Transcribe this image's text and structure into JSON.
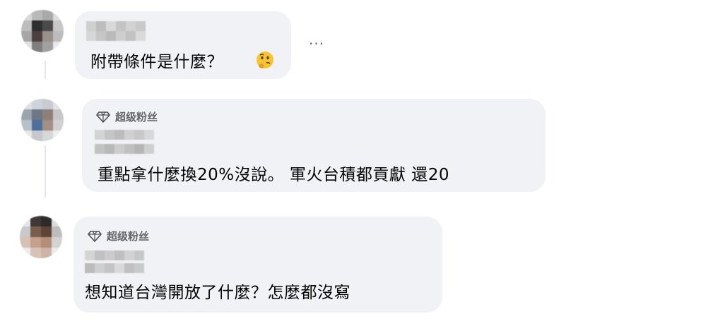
{
  "comments": [
    {
      "text": "附帶條件是什麼？",
      "emoji_icon": "thinking-face-emoji",
      "more_label": "···"
    },
    {
      "badge": "超级粉丝",
      "badge_icon": "diamond-icon",
      "text": "重點拿什麼換20%沒說。 軍火台積都貢獻 還20"
    },
    {
      "badge": "超级粉丝",
      "badge_icon": "diamond-icon",
      "text": "想知道台灣開放了什麼？怎麼都沒寫"
    }
  ],
  "colors": {
    "bubble_background": "#f0f2f5",
    "badge_text": "#65676b",
    "body_text": "#050505"
  }
}
